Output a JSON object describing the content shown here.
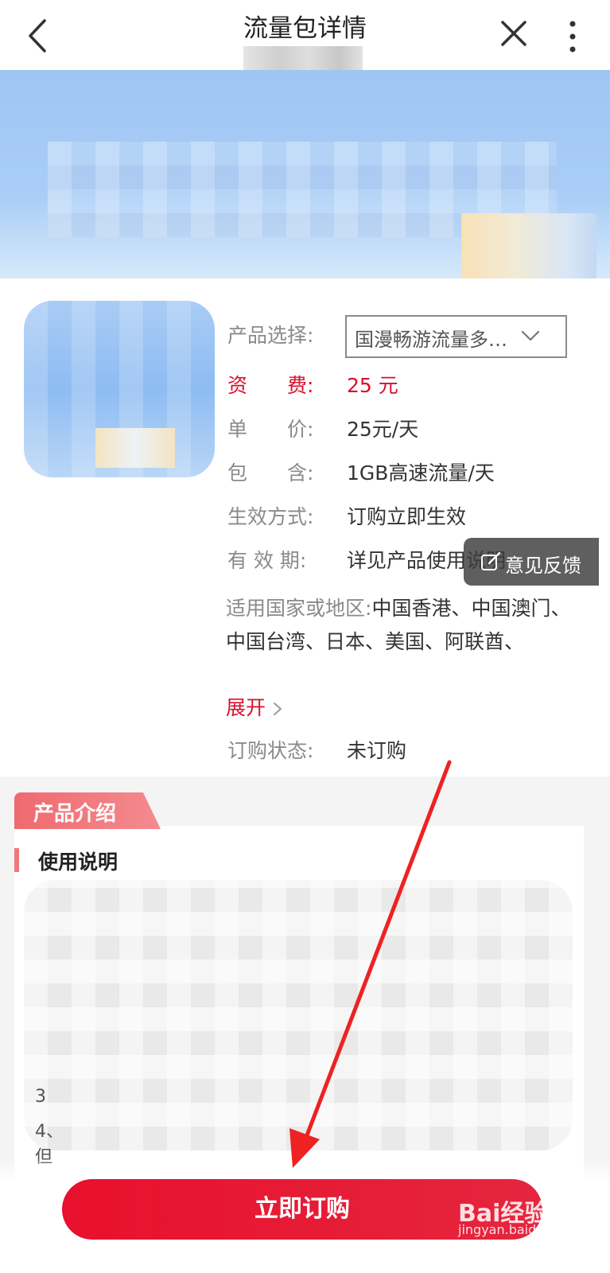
{
  "header": {
    "title": "流量包详情"
  },
  "details": {
    "product_select_label": "产品选择:",
    "product_select_value": "国漫畅游流量多…",
    "fee_label": "资　　费:",
    "fee_value": "25 元",
    "unit_price_label": "单　　价:",
    "unit_price_value": "25元/天",
    "includes_label": "包　　含:",
    "includes_value": "1GB高速流量/天",
    "activation_label": "生效方式:",
    "activation_value": "订购立即生效",
    "validity_label": "有 效 期:",
    "validity_value": "详见产品使用说明",
    "region_label": "适用国家或地区:",
    "region_value": "中国香港、中国澳门、中国台湾、日本、美国、阿联酋、",
    "expand_label": "展开",
    "status_label": "订购状态:",
    "status_value": "未订购"
  },
  "feedback": {
    "label": "意见反馈"
  },
  "intro": {
    "tab_label": "产品介绍",
    "usage_title": "使用说明",
    "visible_numbers": [
      "3",
      "4、",
      "但"
    ]
  },
  "footer": {
    "subscribe_label": "立即订购"
  },
  "watermark": {
    "brand": "Bai经验",
    "url": "jingyan.baidu.com"
  },
  "colors": {
    "accent_red": "#d6102e",
    "button_red": "#e8102d",
    "banner_blue": "#9ec5f4"
  }
}
